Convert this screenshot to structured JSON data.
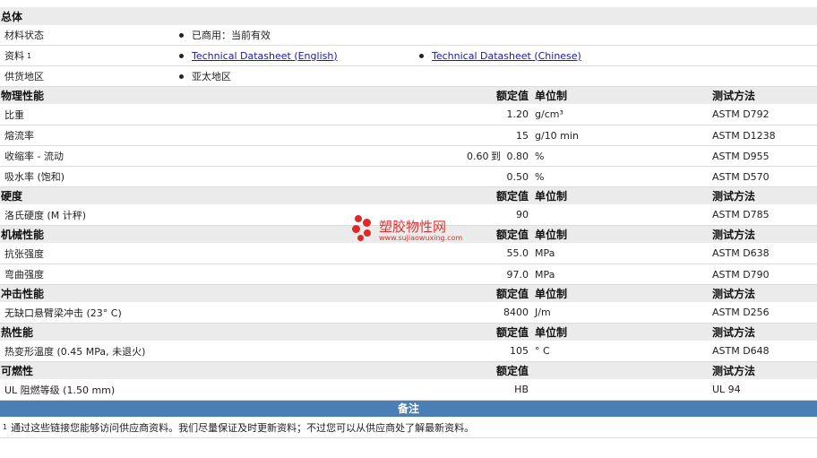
{
  "overview": {
    "header": "总体",
    "material_status_label": "材料状态",
    "material_status_value": "已商用：当前有效",
    "documents_label": "资料",
    "documents_footnote": "1",
    "doc_english": "Technical Datasheet (English)",
    "doc_chinese": "Technical Datasheet (Chinese)",
    "availability_label": "供货地区",
    "availability_value": "亚太地区"
  },
  "columns": {
    "nominal": "额定值",
    "unit": "单位制",
    "test": "测试方法"
  },
  "physical": {
    "header": "物理性能",
    "rows": [
      {
        "name": "比重",
        "value": "1.20",
        "unit": "g/cm³",
        "test": "ASTM D792"
      },
      {
        "name": "熔流率",
        "value": "15",
        "unit": "g/10 min",
        "test": "ASTM D1238"
      },
      {
        "name": "收缩率  - 流动",
        "value_from": "0.60",
        "to": "到",
        "value_to": "0.80",
        "unit": "%",
        "test": "ASTM D955"
      },
      {
        "name": "吸水率  (饱和)",
        "value": "0.50",
        "unit": "%",
        "test": "ASTM D570"
      }
    ]
  },
  "hardness": {
    "header": "硬度",
    "rows": [
      {
        "name": "洛氏硬度  (M 计秤)",
        "value": "90",
        "unit": "",
        "test": "ASTM D785"
      }
    ]
  },
  "mechanical": {
    "header": "机械性能",
    "rows": [
      {
        "name": "抗张强度",
        "value": "55.0",
        "unit": "MPa",
        "test": "ASTM D638"
      },
      {
        "name": "弯曲强度",
        "value": "97.0",
        "unit": "MPa",
        "test": "ASTM D790"
      }
    ]
  },
  "impact": {
    "header": "冲击性能",
    "rows": [
      {
        "name": "无缺口悬臂梁冲击  (23°  C)",
        "value": "8400",
        "unit": "J/m",
        "test": "ASTM D256"
      }
    ]
  },
  "thermal": {
    "header": "热性能",
    "rows": [
      {
        "name": "热变形温度  (0.45 MPa, 未退火)",
        "value": "105",
        "unit": "°  C",
        "test": "ASTM D648"
      }
    ]
  },
  "flammability": {
    "header": "可燃性",
    "rows": [
      {
        "name": "UL 阻燃等级  (1.50 mm)",
        "value": "HB",
        "unit": "",
        "test": "UL 94"
      }
    ]
  },
  "notes": {
    "header": "备注",
    "footnote_number": "1",
    "footnote_text": "通过这些链接您能够访问供应商资料。我们尽量保证及时更新资料；不过您可以从供应商处了解最新资料。"
  },
  "watermark": {
    "title": "塑胶物性网",
    "url": "www.sujiaowuxing.com",
    "color": "#e02828"
  }
}
